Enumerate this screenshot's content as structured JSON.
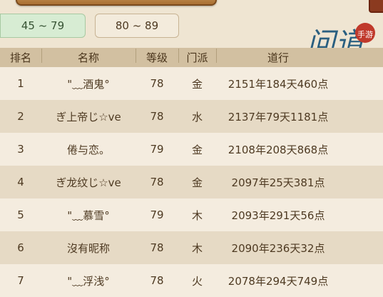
{
  "tabs": [
    {
      "label": "45 ~ 79",
      "active": true
    },
    {
      "label": "80 ~ 89",
      "active": false
    }
  ],
  "logo": {
    "main_text": "问道",
    "sub_text": "手游"
  },
  "table": {
    "headers": [
      "排名",
      "名称",
      "等级",
      "门派",
      "道行"
    ],
    "rows": [
      {
        "rank": "1",
        "name": "\"﹏酒鬼°",
        "level": "78",
        "faction": "金",
        "dao": "2151年184天460点"
      },
      {
        "rank": "2",
        "name": "ぎ上帝じ☆ve",
        "level": "78",
        "faction": "水",
        "dao": "2137年79天1181点"
      },
      {
        "rank": "3",
        "name": "倦与恋。",
        "level": "79",
        "faction": "金",
        "dao": "2108年208天868点"
      },
      {
        "rank": "4",
        "name": "ぎ龙纹じ☆ve",
        "level": "78",
        "faction": "金",
        "dao": "2097年25天381点"
      },
      {
        "rank": "5",
        "name": "\"﹏慕雪°",
        "level": "79",
        "faction": "木",
        "dao": "2093年291天56点"
      },
      {
        "rank": "6",
        "name": "沒有昵称",
        "level": "78",
        "faction": "木",
        "dao": "2090年236天32点"
      },
      {
        "rank": "7",
        "name": "\"﹏浮浅°",
        "level": "78",
        "faction": "火",
        "dao": "2078年294天749点"
      }
    ]
  }
}
